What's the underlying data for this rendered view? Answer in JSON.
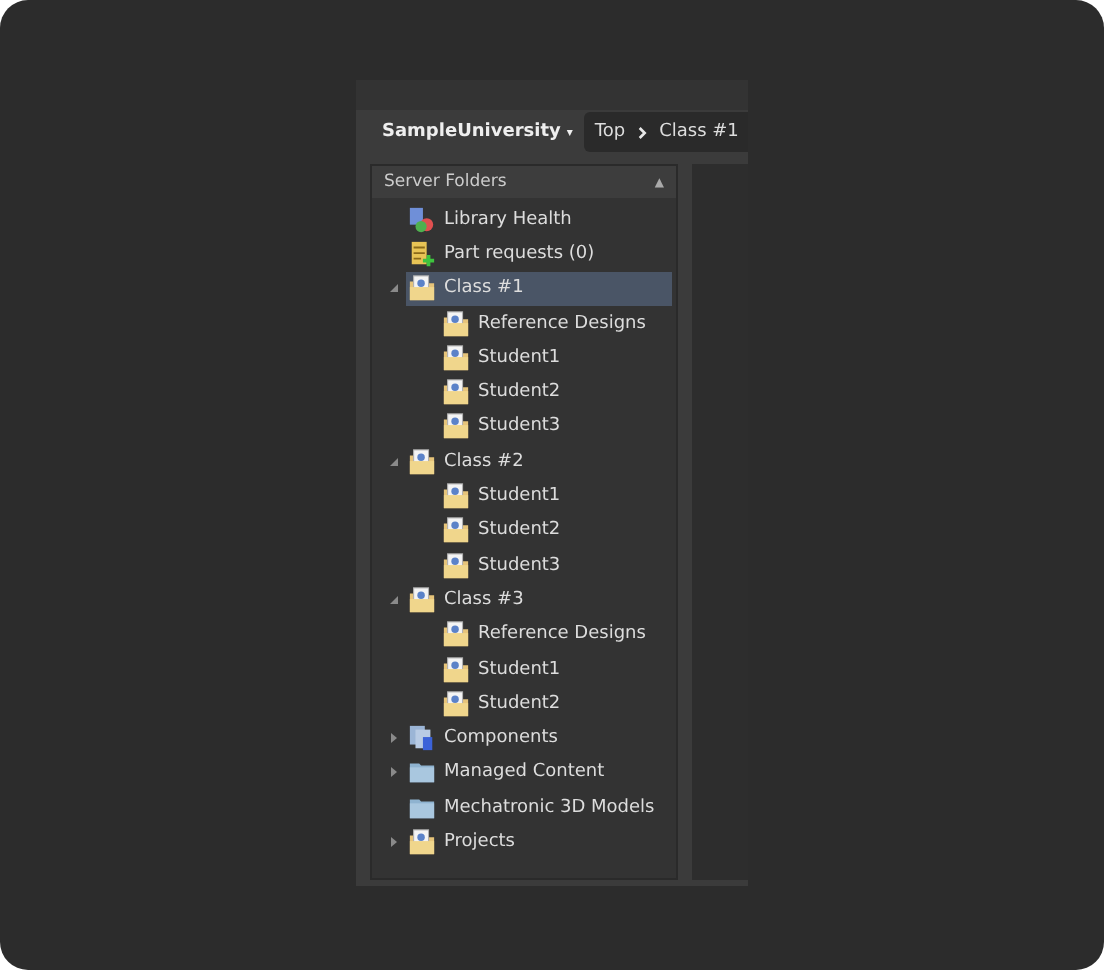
{
  "toolbar": {
    "server": "SampleUniversity",
    "server_caret": "▾",
    "breadcrumb": [
      {
        "label": "Top"
      },
      {
        "label": "Class #1"
      }
    ]
  },
  "sidebar": {
    "title": "Server Folders",
    "collapse_glyph": "▲",
    "items": [
      {
        "label": "Library Health",
        "kind": "health",
        "selected": false
      },
      {
        "label": "Part requests (0)",
        "kind": "requests",
        "selected": false
      },
      {
        "label": "Class #1",
        "kind": "shared",
        "selected": true,
        "expanded": true,
        "children": [
          {
            "label": "Reference Designs",
            "kind": "shared",
            "selected": false
          },
          {
            "label": "Student1",
            "kind": "shared",
            "selected": false
          },
          {
            "label": "Student2",
            "kind": "shared",
            "selected": false
          },
          {
            "label": "Student3",
            "kind": "shared",
            "selected": false
          }
        ]
      },
      {
        "label": "Class #2",
        "kind": "shared",
        "selected": false,
        "expanded": true,
        "children": [
          {
            "label": "Student1",
            "kind": "shared",
            "selected": false
          },
          {
            "label": "Student2",
            "kind": "shared",
            "selected": false
          },
          {
            "label": "Student3",
            "kind": "shared",
            "selected": false
          }
        ]
      },
      {
        "label": "Class #3",
        "kind": "shared",
        "selected": false,
        "expanded": true,
        "children": [
          {
            "label": "Reference Designs",
            "kind": "shared",
            "selected": false
          },
          {
            "label": "Student1",
            "kind": "shared",
            "selected": false
          },
          {
            "label": "Student2",
            "kind": "shared",
            "selected": false
          }
        ]
      },
      {
        "label": "Components",
        "kind": "components",
        "selected": false,
        "expanded": false
      },
      {
        "label": "Managed Content",
        "kind": "folder",
        "selected": false,
        "expanded": false
      },
      {
        "label": "Mechatronic 3D Models",
        "kind": "folder",
        "selected": false
      },
      {
        "label": "Projects",
        "kind": "shared",
        "selected": false,
        "expanded": false
      }
    ]
  }
}
